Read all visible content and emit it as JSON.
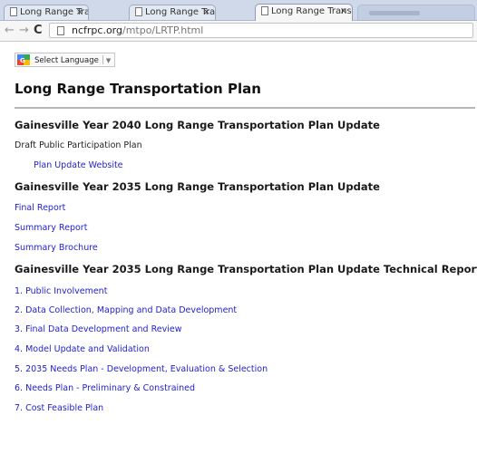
{
  "browser": {
    "tabs": [
      {
        "label": "Long Range Transpo",
        "close": "×"
      },
      {
        "label": "Long Range Transpo",
        "close": "×"
      },
      {
        "label": "Long Range Transpo",
        "close": "×"
      }
    ],
    "nav": {
      "back": "←",
      "forward": "→",
      "reload": "C"
    },
    "url_host": "ncfrpc.org",
    "url_path": "/mtpo/LRTP.html"
  },
  "translate": {
    "label": "Select Language",
    "arrow": "▼"
  },
  "page": {
    "title": "Long Range Transportation Plan",
    "sections": [
      {
        "heading": "Gainesville Year 2040 Long Range Transportation Plan Update",
        "text": "Draft Public Participation Plan",
        "links": [
          "Plan Update Website"
        ]
      },
      {
        "heading": "Gainesville Year 2035 Long Range Transportation Plan Update",
        "links": [
          "Final Report",
          "Summary Report",
          "Summary Brochure"
        ]
      },
      {
        "heading": "Gainesville Year 2035 Long Range Transportation Plan Update Technical Reports",
        "links": [
          "1. Public Involvement",
          "2. Data Collection, Mapping and Data Development",
          "3. Final Data Development and Review",
          "4. Model Update and Validation",
          "5. 2035 Needs Plan - Development, Evaluation & Selection",
          "6. Needs Plan - Preliminary & Constrained",
          "7. Cost Feasible Plan"
        ]
      }
    ]
  },
  "colors": {
    "link": "#2222cc",
    "tab_strip": "#cfd9ea"
  }
}
